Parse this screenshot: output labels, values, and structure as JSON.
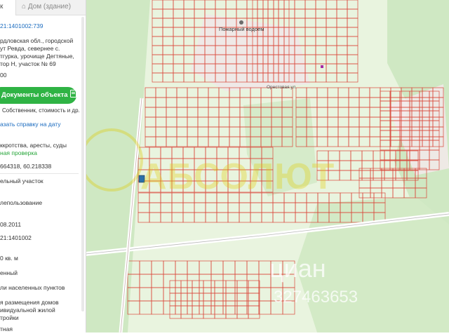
{
  "panel": {
    "tab_active": "к",
    "tab_building": "Дом (здание)",
    "cadastral_number": "21:1401002:739",
    "address": [
      "рдловская обл., городской",
      "ут Ревда, севернее с.",
      "тгурка, урочище Дегтяные,",
      "тор Н, участок № 69"
    ],
    "number_line": "00",
    "documents_button": "Документы объекта",
    "documents_caption": "Собственник, стоимость и др.",
    "certificate_link": "азать справку на дату",
    "checks_text": "ккротства, аресты, суды",
    "checks_link": "ная проверка",
    "coordinates": "664318, 60.218338",
    "object_type": "ельный участок",
    "land_use": "лепользование",
    "date": "08.2011",
    "quarter": "21:1401002",
    "area": "0 кв. м",
    "status": "енный",
    "category": "ли населенных пунктов",
    "permitted_use": [
      "я размещения домов",
      "ивидуальной жилой",
      "тройки"
    ],
    "last_line": "тная"
  },
  "map": {
    "labels": {
      "fire_pond": "Пожарный водоем",
      "street_orestovaya": "Орестовая ул."
    },
    "colors": {
      "forest": "#cfe8c3",
      "meadow": "#e9f4df",
      "plot_line": "#d9483b",
      "road": "#ffffff",
      "parcel_fill": "#e8d7d7"
    }
  },
  "watermarks": {
    "absolut": "АБСОЛЮТ",
    "cian": "циан",
    "phone": "327463653"
  }
}
